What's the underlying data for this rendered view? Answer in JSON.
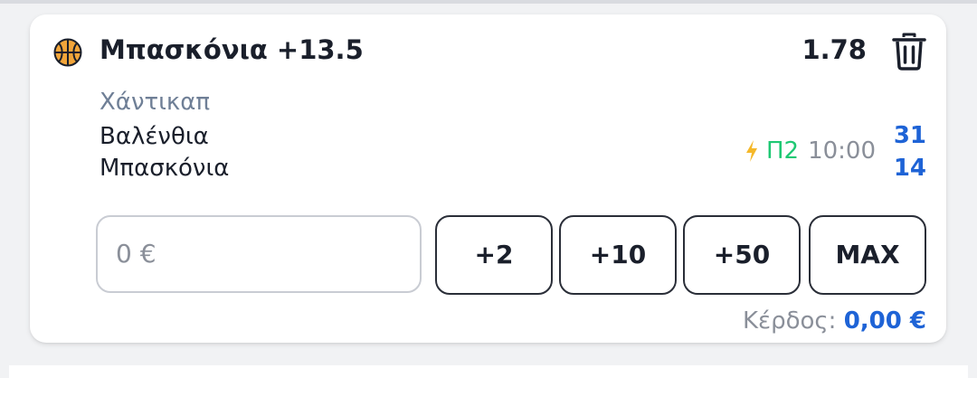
{
  "bet": {
    "selection": "Μπασκόνια +13.5",
    "odds": "1.78",
    "market": "Χάντικαπ",
    "home_team": "Βαλένθια",
    "away_team": "Μπασκόνια",
    "period": "Π2",
    "clock": "10:00",
    "home_score": "31",
    "away_score": "14"
  },
  "stake": {
    "placeholder": "0 €"
  },
  "quick_stakes": [
    "+2",
    "+10",
    "+50",
    "MAX"
  ],
  "profit": {
    "label": "Κέρδος:",
    "value": "0,00 €"
  },
  "icons": {
    "sport": "basketball-icon",
    "delete": "trash-icon",
    "live": "lightning-icon"
  },
  "colors": {
    "accent_blue": "#1e63d6",
    "live_green": "#1ec873",
    "bolt_yellow": "#f5b829",
    "ball_orange": "#f2a53a"
  }
}
